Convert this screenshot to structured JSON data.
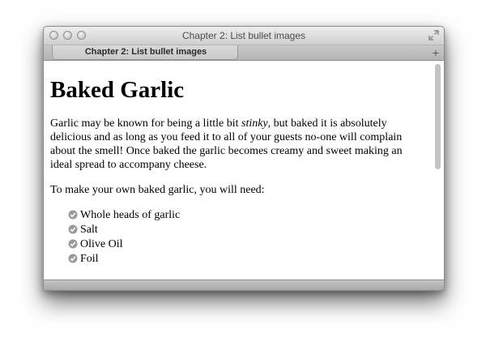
{
  "window": {
    "title": "Chapter 2: List bullet images"
  },
  "tabs": [
    {
      "label": "Chapter 2: List bullet images"
    }
  ],
  "new_tab_label": "+",
  "page": {
    "heading": "Baked Garlic",
    "intro_before": "Garlic may be known for being a little bit ",
    "intro_em": "stinky",
    "intro_after": ", but baked it is absolutely delicious and as long as you feed it to all of your guests no-one will complain about the smell! Once baked the garlic becomes creamy and sweet making an ideal spread to accompany cheese.",
    "need": "To make your own baked garlic, you will need:",
    "items": [
      "Whole heads of garlic",
      "Salt",
      "Olive Oil",
      "Foil"
    ]
  },
  "icons": {
    "bullet": "check-icon",
    "fullscreen": "fullscreen-icon"
  }
}
